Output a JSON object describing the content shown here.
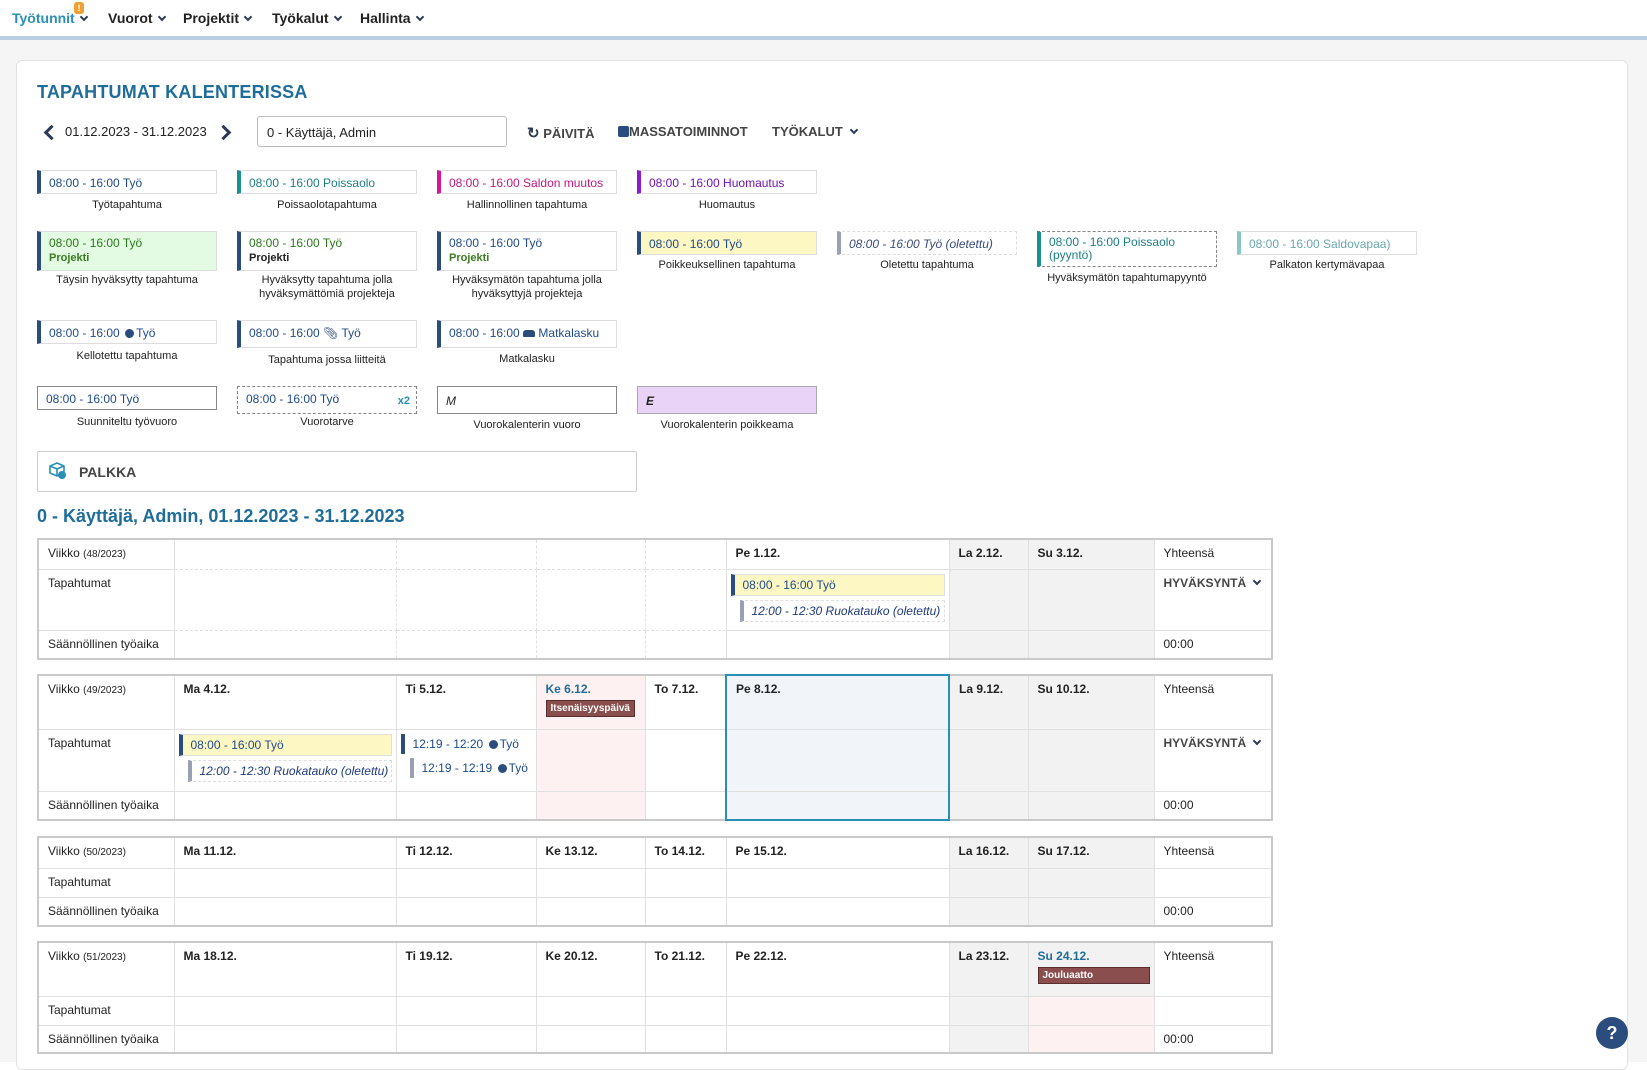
{
  "nav": {
    "items": [
      "Työtunnit",
      "Vuorot",
      "Projektit",
      "Työkalut",
      "Hallinta"
    ],
    "badge": "!"
  },
  "page_title": "TAPAHTUMAT KALENTERISSA",
  "toolbar": {
    "date_range": "01.12.2023 - 31.12.2023",
    "user": "0 - Käyttäjä, Admin",
    "refresh": "PÄIVITÄ",
    "mass": "MASSATOIMINNOT",
    "tools": "TYÖKALUT"
  },
  "legend": {
    "l1": {
      "time": "08:00 - 16:00 Työ",
      "cap": "Työtapahtuma"
    },
    "l2": {
      "time": "08:00 - 16:00 Poissaolo",
      "cap": "Poissaolotapahtuma"
    },
    "l3": {
      "time": "08:00 - 16:00 Saldon muutos",
      "cap": "Hallinnollinen tapahtuma"
    },
    "l4": {
      "time": "08:00 - 16:00 Huomautus",
      "cap": "Huomautus"
    },
    "l5": {
      "time": "08:00 - 16:00 Työ",
      "sub": "Projekti",
      "cap": "Täysin hyväksytty tapahtuma"
    },
    "l6": {
      "time": "08:00 - 16:00 Työ",
      "sub": "Projekti",
      "cap": "Hyväksytty tapahtuma jolla hyväksymättömiä projekteja"
    },
    "l7": {
      "time": "08:00 - 16:00 Työ",
      "sub": "Projekti",
      "cap": "Hyväksymätön tapahtuma jolla hyväksyttyjä projekteja"
    },
    "l8": {
      "time": "08:00 - 16:00 Työ",
      "cap": "Poikkeuksellinen tapahtuma"
    },
    "l9": {
      "time": "08:00 - 16:00 Työ (oletettu)",
      "cap": "Oletettu tapahtuma"
    },
    "l10": {
      "time": "08:00 - 16:00 Poissaolo",
      "time2": "(pyyntö)",
      "cap": "Hyväksymätön tapahtumapyyntö"
    },
    "l11": {
      "time": "08:00 - 16:00 Saldovapaa)",
      "cap": "Palkaton kertymävapaa"
    },
    "l12": {
      "time": "08:00 - 16:00",
      "label": "Työ",
      "cap": "Kellotettu tapahtuma"
    },
    "l13": {
      "time": "08:00 - 16:00",
      "label": "Työ",
      "cap": "Tapahtuma jossa liitteitä"
    },
    "l14": {
      "time": "08:00 - 16:00",
      "label": "Matkalasku",
      "cap": "Matkalasku"
    },
    "l15": {
      "time": "08:00 - 16:00 Työ",
      "cap": "Suunniteltu työvuoro"
    },
    "l16": {
      "time": "08:00 - 16:00 Työ",
      "count": "x2",
      "cap": "Vuorotarve"
    },
    "l17": {
      "letter": "M",
      "cap": "Vuorokalenterin vuoro"
    },
    "l18": {
      "letter": "E",
      "cap": "Vuorokalenterin poikkeama"
    }
  },
  "palkka": "PALKKA",
  "calendar_title": "0 - Käyttäjä, Admin, 01.12.2023 - 31.12.2023",
  "rows": {
    "week": "Viikko",
    "events": "Tapahtumat",
    "regular": "Säännöllinen työaika",
    "total": "Yhteensä",
    "approval": "HYVÄKSYNTÄ",
    "zero": "00:00"
  },
  "weeks": [
    {
      "num": "(48/2023)",
      "days": [
        "",
        "",
        "",
        "",
        "Pe 1.12.",
        "La 2.12.",
        "Su 3.12."
      ],
      "ev_main": "08:00 - 16:00 Työ",
      "ev_sub": "12:00 - 12:30 Ruokatauko (oletettu)"
    },
    {
      "num": "(49/2023)",
      "days": [
        "Ma 4.12.",
        "Ti 5.12.",
        "Ke 6.12.",
        "To 7.12.",
        "Pe 8.12.",
        "La 9.12.",
        "Su 10.12."
      ],
      "holiday": "Itsenäisyyspäivä",
      "ev_main": "08:00 - 16:00 Työ",
      "ev_sub": "12:00 - 12:30 Ruokatauko (oletettu)",
      "ev_a_time": "12:19 - 12:20",
      "ev_a_label": "Työ",
      "ev_b_time": "12:19 - 12:19",
      "ev_b_label": "Työ"
    },
    {
      "num": "(50/2023)",
      "days": [
        "Ma 11.12.",
        "Ti 12.12.",
        "Ke 13.12.",
        "To 14.12.",
        "Pe 15.12.",
        "La 16.12.",
        "Su 17.12."
      ]
    },
    {
      "num": "(51/2023)",
      "days": [
        "Ma 18.12.",
        "Ti 19.12.",
        "Ke 20.12.",
        "To 21.12.",
        "Pe 22.12.",
        "La 23.12.",
        "Su 24.12."
      ],
      "holiday": "Jouluaatto"
    }
  ],
  "help": "?"
}
